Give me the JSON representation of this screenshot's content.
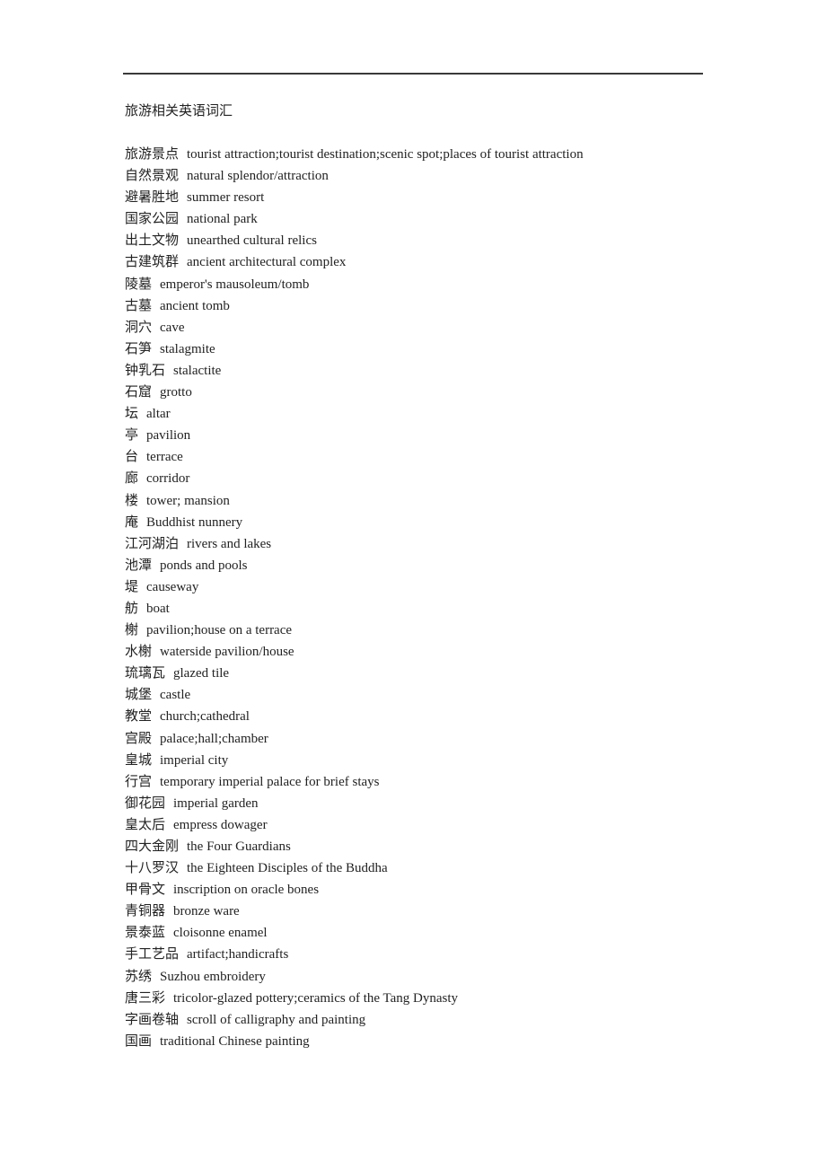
{
  "document": {
    "title": "旅游相关英语词汇",
    "entries": [
      {
        "zh": "旅游景点",
        "en": "tourist attraction;tourist destination;scenic spot;places of tourist attraction"
      },
      {
        "zh": "自然景观",
        "en": "natural splendor/attraction"
      },
      {
        "zh": "避暑胜地",
        "en": "summer resort"
      },
      {
        "zh": "国家公园",
        "en": "national park"
      },
      {
        "zh": "出土文物",
        "en": "unearthed cultural relics"
      },
      {
        "zh": "古建筑群",
        "en": "ancient architectural complex"
      },
      {
        "zh": "陵墓",
        "en": "emperor's mausoleum/tomb"
      },
      {
        "zh": "古墓",
        "en": "ancient tomb"
      },
      {
        "zh": "洞穴",
        "en": "cave"
      },
      {
        "zh": "石笋",
        "en": "stalagmite"
      },
      {
        "zh": "钟乳石",
        "en": "stalactite"
      },
      {
        "zh": "石窟",
        "en": "grotto"
      },
      {
        "zh": "坛",
        "en": "altar"
      },
      {
        "zh": "亭",
        "en": "pavilion"
      },
      {
        "zh": "台",
        "en": "terrace"
      },
      {
        "zh": "廊",
        "en": "corridor"
      },
      {
        "zh": "楼",
        "en": "tower; mansion"
      },
      {
        "zh": "庵",
        "en": "Buddhist nunnery"
      },
      {
        "zh": "江河湖泊",
        "en": "rivers and lakes"
      },
      {
        "zh": "池潭",
        "en": "ponds and pools"
      },
      {
        "zh": "堤",
        "en": "causeway"
      },
      {
        "zh": "舫",
        "en": "boat"
      },
      {
        "zh": "榭",
        "en": "pavilion;house on a terrace"
      },
      {
        "zh": "水榭",
        "en": "waterside pavilion/house"
      },
      {
        "zh": "琉璃瓦",
        "en": "glazed tile"
      },
      {
        "zh": "城堡",
        "en": "castle"
      },
      {
        "zh": "教堂",
        "en": "church;cathedral"
      },
      {
        "zh": "宫殿",
        "en": "palace;hall;chamber"
      },
      {
        "zh": "皇城",
        "en": "imperial city"
      },
      {
        "zh": "行宫",
        "en": "temporary imperial palace for brief stays"
      },
      {
        "zh": "御花园",
        "en": "imperial garden"
      },
      {
        "zh": "皇太后",
        "en": "empress dowager"
      },
      {
        "zh": "四大金刚",
        "en": "the Four Guardians"
      },
      {
        "zh": "十八罗汉",
        "en": "the Eighteen Disciples of the Buddha"
      },
      {
        "zh": "甲骨文",
        "en": "inscription on oracle bones"
      },
      {
        "zh": "青铜器",
        "en": "bronze ware"
      },
      {
        "zh": "景泰蓝",
        "en": "cloisonne enamel"
      },
      {
        "zh": "手工艺品",
        "en": "artifact;handicrafts"
      },
      {
        "zh": "苏绣",
        "en": "Suzhou embroidery"
      },
      {
        "zh": "唐三彩",
        "en": "tricolor-glazed pottery;ceramics of the Tang Dynasty"
      },
      {
        "zh": "字画卷轴",
        "en": "scroll of calligraphy and painting"
      },
      {
        "zh": "国画",
        "en": "traditional Chinese painting"
      }
    ]
  }
}
